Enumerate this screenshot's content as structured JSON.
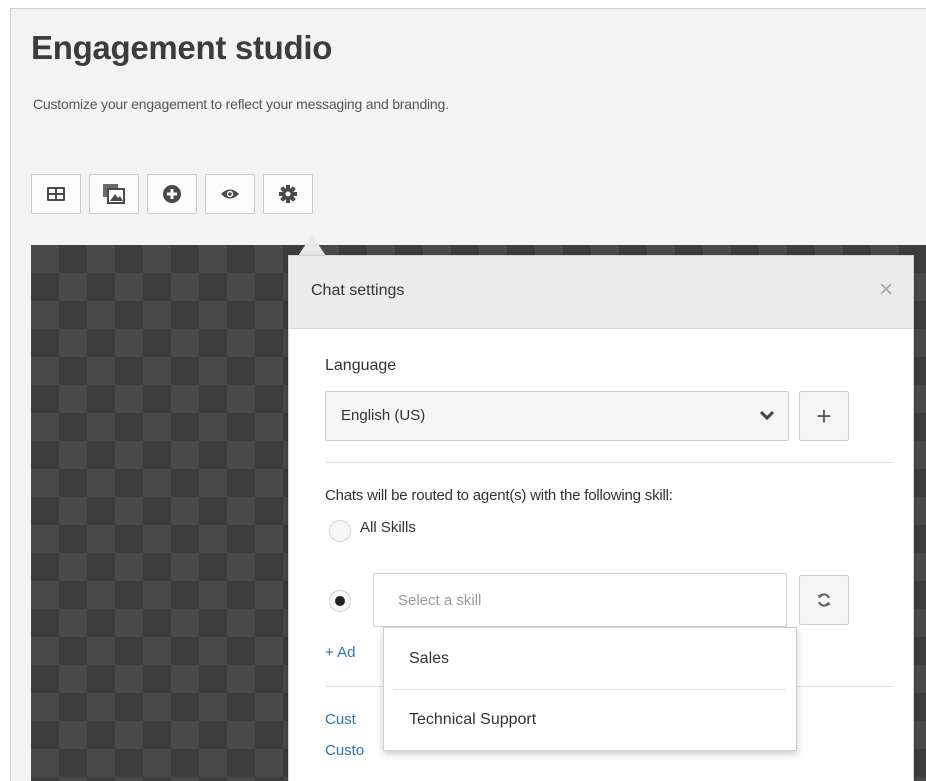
{
  "page": {
    "title": "Engagement studio",
    "subtitle": "Customize your engagement to reflect your messaging and branding."
  },
  "toolbar": {
    "buttons": [
      {
        "icon": "layout-icon"
      },
      {
        "icon": "image-layers-icon"
      },
      {
        "icon": "add-circle-icon"
      },
      {
        "icon": "eye-icon"
      },
      {
        "icon": "gear-icon"
      }
    ]
  },
  "settings_panel": {
    "title": "Chat settings",
    "close_glyph": "×",
    "language_label": "Language",
    "language_value": "English (US)",
    "add_glyph": "+",
    "routing_description": "Chats will be routed to agent(s) with the following skill:",
    "all_skills_label": "All Skills",
    "skill_placeholder": "Select a skill",
    "add_skill_link": "+ Ad",
    "customize_link_1": "Cust",
    "customize_link_2": "Custo",
    "skill_options": [
      "Sales",
      "Technical Support"
    ]
  },
  "colors": {
    "link": "#2a74b4",
    "canvas_dark": "#4a4a4a",
    "canvas_check": "#3d3d3d",
    "panel_header": "#ebebeb"
  }
}
